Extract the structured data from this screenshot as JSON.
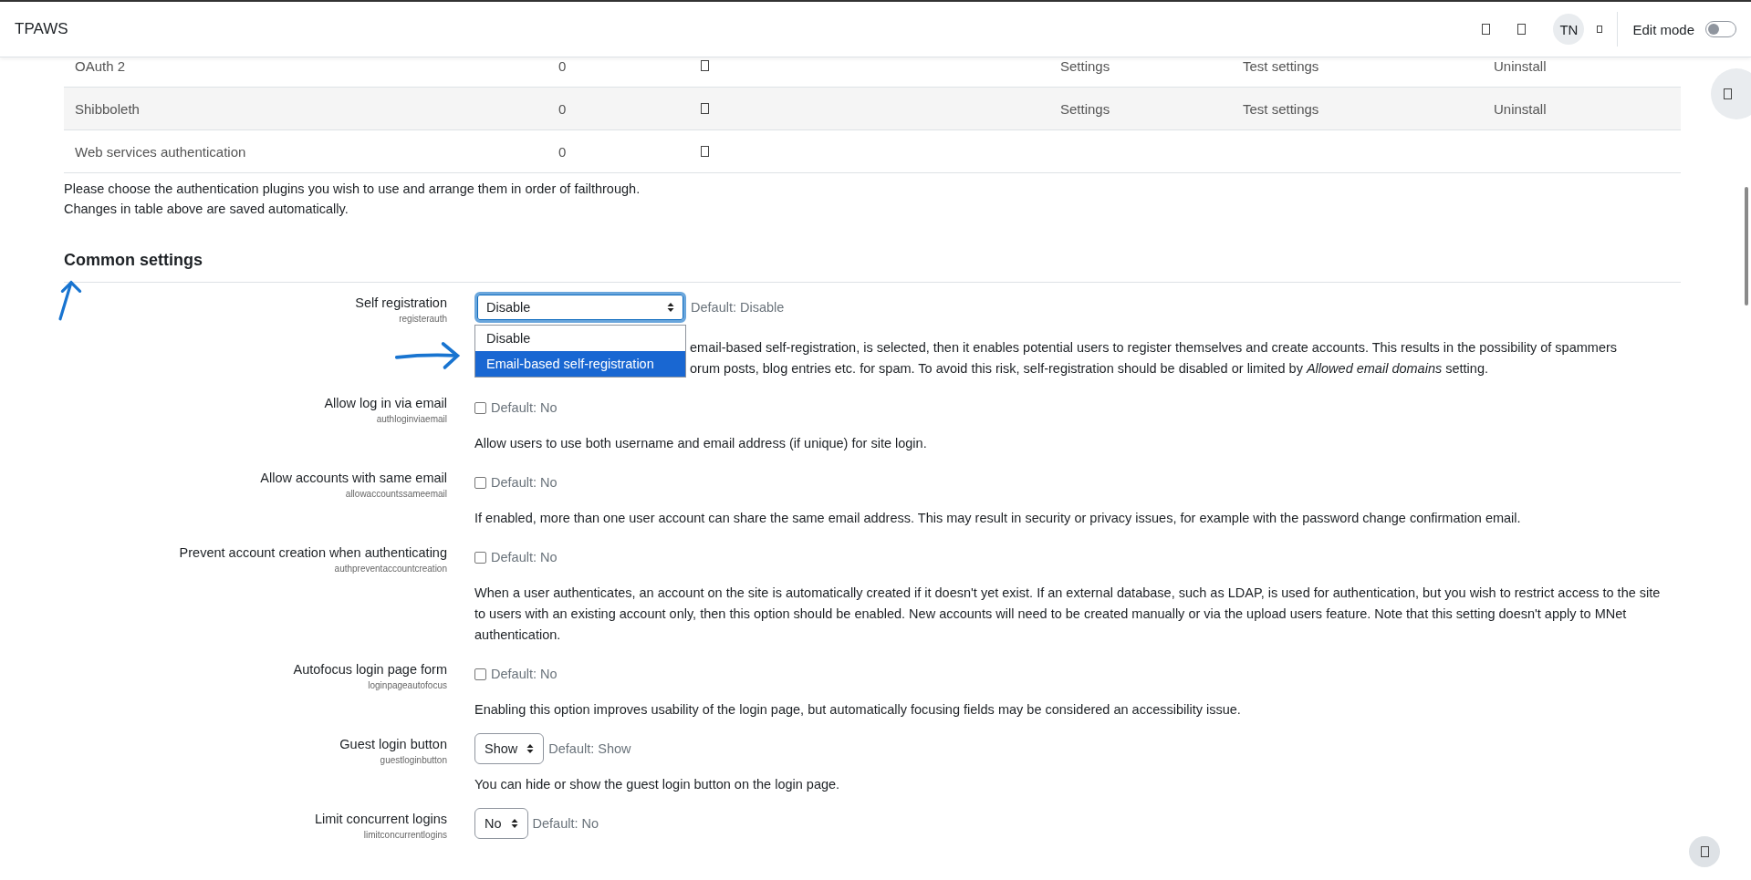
{
  "header": {
    "brand": "TPAWS",
    "avatar": "TN",
    "edit_mode": {
      "label": "Edit mode",
      "on": false
    }
  },
  "auth_table": {
    "rows": [
      {
        "name": "OAuth 2",
        "count": "0",
        "settings": "Settings",
        "test_settings": "Test settings",
        "uninstall": "Uninstall"
      },
      {
        "name": "Shibboleth",
        "count": "0",
        "settings": "Settings",
        "test_settings": "Test settings",
        "uninstall": "Uninstall"
      },
      {
        "name": "Web services authentication",
        "count": "0"
      }
    ]
  },
  "notes": [
    "Please choose the authentication plugins you wish to use and arrange them in order of failthrough.",
    "Changes in table above are saved automatically."
  ],
  "section_title": "Common settings",
  "settings": [
    {
      "kind": "select",
      "label": "Self registration",
      "name": "registerauth",
      "value": "Disable",
      "default": "Default: Disable",
      "open": true,
      "options": [
        {
          "label": "Disable",
          "highlighted": false
        },
        {
          "label": "Email-based self-registration",
          "highlighted": true
        }
      ],
      "description": [
        "email-based self-registration, is selected, then it enables potential users to register themselves and create accounts. This results in the possibility of spammers",
        "orum posts, blog entries etc. for spam. To avoid this risk, self-registration should be disabled or limited by *Allowed email domains* setting."
      ]
    },
    {
      "kind": "checkbox",
      "label": "Allow log in via email",
      "name": "authloginviaemail",
      "checked": false,
      "default": "Default: No",
      "description": [
        "Allow users to use both username and email address (if unique) for site login."
      ]
    },
    {
      "kind": "checkbox",
      "label": "Allow accounts with same email",
      "name": "allowaccountssameemail",
      "checked": false,
      "default": "Default: No",
      "description": [
        "If enabled, more than one user account can share the same email address. This may result in security or privacy issues, for example with the password change confirmation email."
      ]
    },
    {
      "kind": "checkbox",
      "label": "Prevent account creation when authenticating",
      "name": "authpreventaccountcreation",
      "checked": false,
      "default": "Default: No",
      "description": [
        "When a user authenticates, an account on the site is automatically created if it doesn't yet exist. If an external database, such as LDAP, is used for authentication, but you wish to restrict access to the site to users with an existing account only, then this option should be enabled. New accounts will need to be created manually or via the upload users feature. Note that this setting doesn't apply to MNet authentication."
      ]
    },
    {
      "kind": "checkbox",
      "label": "Autofocus login page form",
      "name": "loginpageautofocus",
      "checked": false,
      "default": "Default: No",
      "description": [
        "Enabling this option improves usability of the login page, but automatically focusing fields may be considered an accessibility issue."
      ]
    },
    {
      "kind": "select",
      "label": "Guest login button",
      "name": "guestloginbutton",
      "value": "Show",
      "default": "Default: Show",
      "open": false,
      "description": [
        "You can hide or show the guest login button on the login page."
      ]
    },
    {
      "kind": "select",
      "label": "Limit concurrent logins",
      "name": "limitconcurrentlogins",
      "value": "No",
      "default": "Default: No",
      "open": false
    }
  ]
}
